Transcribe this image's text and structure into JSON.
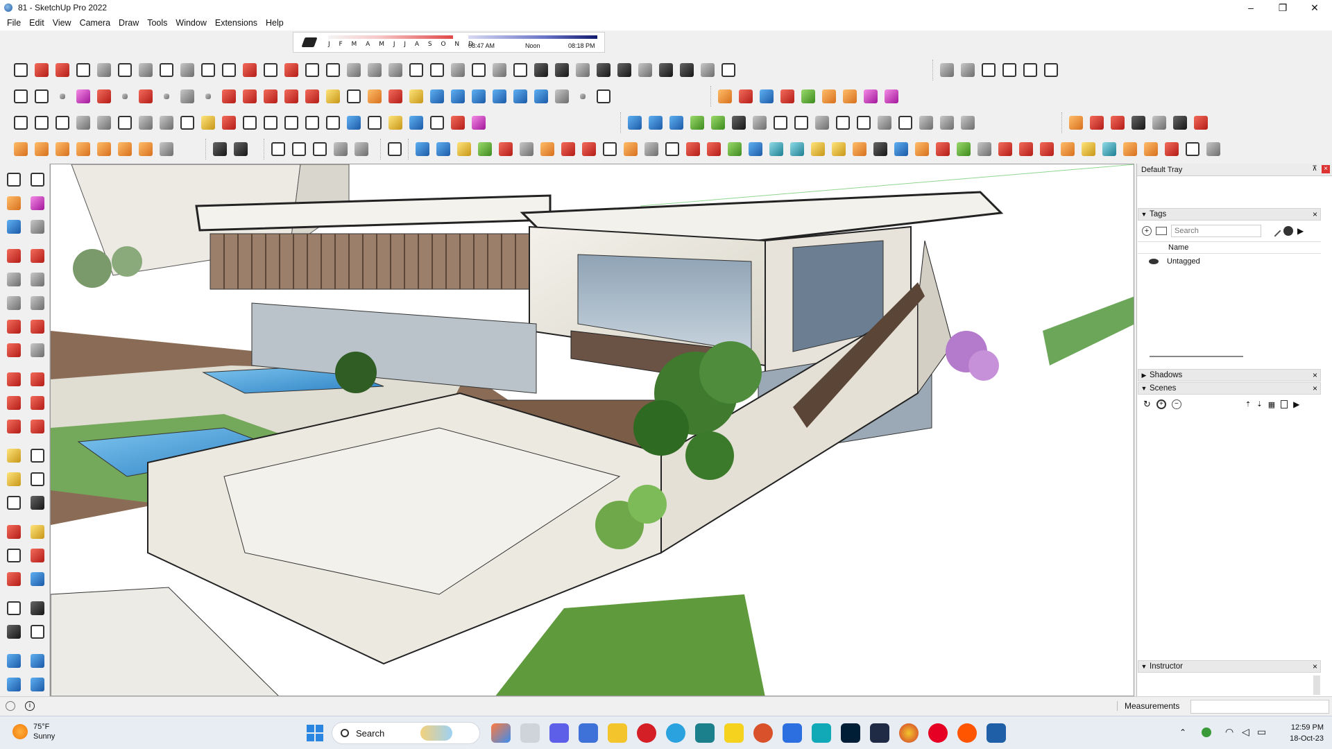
{
  "window": {
    "title": "81 - SketchUp Pro 2022",
    "controls": [
      "–",
      "❐",
      "✕"
    ]
  },
  "menu": [
    "File",
    "Edit",
    "View",
    "Camera",
    "Draw",
    "Tools",
    "Window",
    "Extensions",
    "Help"
  ],
  "timeline": {
    "months": "J F M A M J J A S O N D",
    "sunrise": "08:47 AM",
    "noon": "Noon",
    "sunset": "08:18 PM"
  },
  "tray": {
    "title": "Default Tray",
    "tags": {
      "title": "Tags",
      "search_placeholder": "Search",
      "column": "Name",
      "rows": [
        "Untagged"
      ]
    },
    "shadows": {
      "title": "Shadows"
    },
    "scenes": {
      "title": "Scenes"
    },
    "instructor": {
      "title": "Instructor"
    }
  },
  "status": {
    "measurements_label": "Measurements"
  },
  "taskbar": {
    "weather_temp": "75°F",
    "weather_desc": "Sunny",
    "search_label": "Search",
    "time": "12:59 PM",
    "date": "18-Oct-23"
  }
}
